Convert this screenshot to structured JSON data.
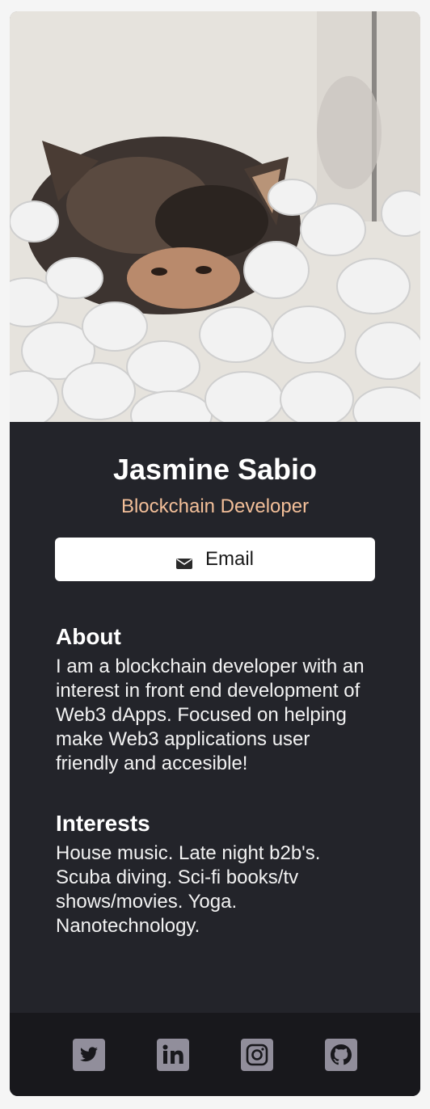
{
  "profile": {
    "name": "Jasmine Sabio",
    "title": "Blockchain Developer",
    "email_label": "Email"
  },
  "about": {
    "heading": "About",
    "text": "I am a blockchain developer with an interest in front end development of Web3 dApps. Focused on helping make Web3 applications user friendly and accesible!"
  },
  "interests": {
    "heading": "Interests",
    "text": "House music. Late night b2b's. Scuba diving. Sci-fi books/tv shows/movies. Yoga. Nanotechnology."
  },
  "social": {
    "icons": [
      "twitter-icon",
      "linkedin-icon",
      "instagram-icon",
      "github-icon"
    ]
  },
  "colors": {
    "card_background": "#23242a",
    "footer_background": "#18181c",
    "title_accent": "#f3bf99",
    "icon_color": "#918e9b"
  }
}
